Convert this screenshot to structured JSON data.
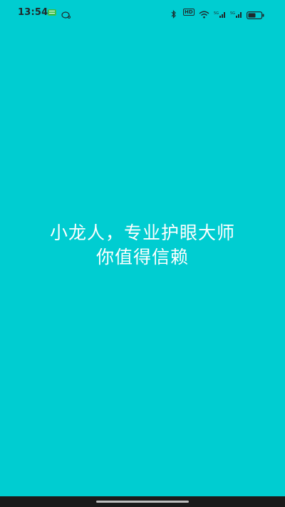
{
  "status_bar": {
    "time": "13:54",
    "hd_label": "HD"
  },
  "main": {
    "line1": "小龙人，专业护眼大师",
    "line2": "你值得信赖"
  },
  "colors": {
    "background": "#00CDD1",
    "text": "#FFFFFF",
    "status_text": "#1F2A2C"
  },
  "icons": [
    "message-icon",
    "chat-icon",
    "bluetooth-icon",
    "hd-icon",
    "wifi-icon",
    "signal-icon",
    "signal-icon",
    "battery-icon"
  ]
}
